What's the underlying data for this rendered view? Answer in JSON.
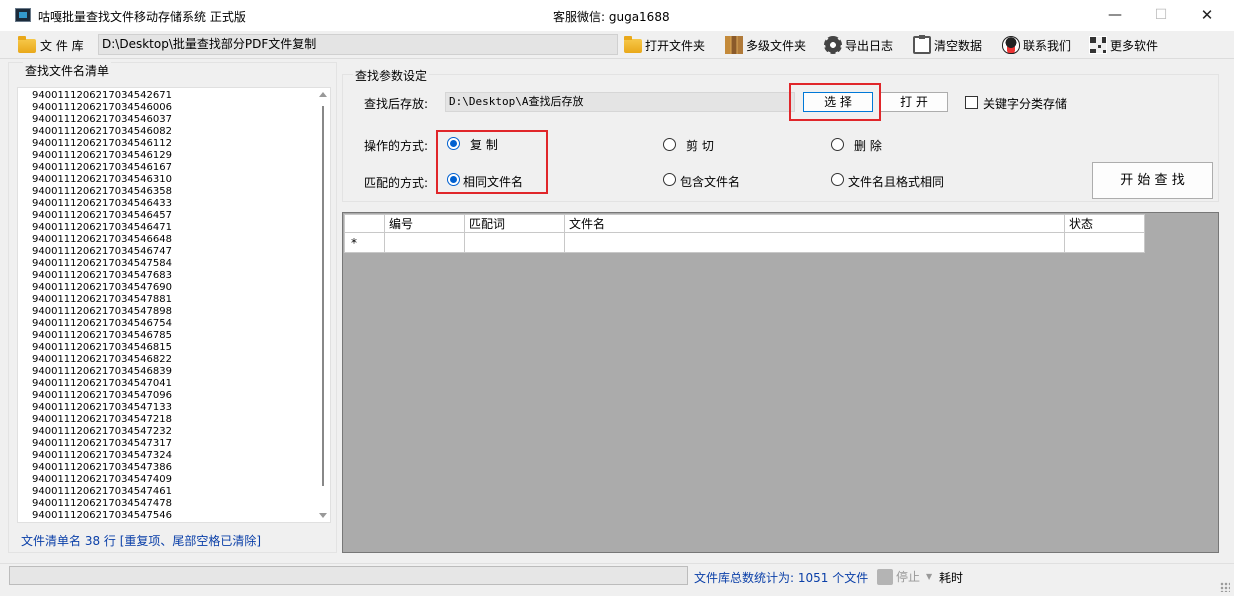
{
  "window": {
    "title": "咕嘎批量查找文件移动存储系统  正式版",
    "center_text": "客服微信: guga1688",
    "controls": {
      "minimize": "—",
      "maximize": "☐",
      "close": "✕"
    }
  },
  "toolbar": {
    "library_label": "文 件 库",
    "library_path": "D:\\Desktop\\批量查找部分PDF文件复制",
    "buttons": {
      "open_folder": "打开文件夹",
      "multi_folder": "多级文件夹",
      "export_log": "导出日志",
      "clear_data": "清空数据",
      "contact_us": "联系我们",
      "more_software": "更多软件"
    }
  },
  "file_list": {
    "title": "查找文件名清单",
    "items": [
      "9400111206217034542671",
      "9400111206217034546006",
      "9400111206217034546037",
      "9400111206217034546082",
      "9400111206217034546112",
      "9400111206217034546129",
      "9400111206217034546167",
      "9400111206217034546310",
      "9400111206217034546358",
      "9400111206217034546433",
      "9400111206217034546457",
      "9400111206217034546471",
      "9400111206217034546648",
      "9400111206217034546747",
      "9400111206217034547584",
      "9400111206217034547683",
      "9400111206217034547690",
      "9400111206217034547881",
      "9400111206217034547898",
      "9400111206217034546754",
      "9400111206217034546785",
      "9400111206217034546815",
      "9400111206217034546822",
      "9400111206217034546839",
      "9400111206217034547041",
      "9400111206217034547096",
      "9400111206217034547133",
      "9400111206217034547218",
      "9400111206217034547232",
      "9400111206217034547317",
      "9400111206217034547324",
      "9400111206217034547386",
      "9400111206217034547409",
      "9400111206217034547461",
      "9400111206217034547478",
      "9400111206217034547546"
    ],
    "status": "文件清单名 38 行  [重复项、尾部空格已清除]"
  },
  "settings": {
    "title": "查找参数设定",
    "save_label": "查找后存放:",
    "save_path": "D:\\Desktop\\A查找后存放",
    "select_button": "选  择",
    "open_button": "打  开",
    "keyword_checkbox": "关键字分类存储",
    "operation_label": "操作的方式:",
    "operations": {
      "copy": "复  制",
      "cut": "剪  切",
      "delete": "删  除"
    },
    "match_label": "匹配的方式:",
    "matches": {
      "same_name": "相同文件名",
      "contains_name": "包含文件名",
      "same_name_format": "文件名且格式相同"
    },
    "start_button": "开 始 查 找"
  },
  "grid": {
    "columns": [
      "编号",
      "匹配词",
      "文件名",
      "状态"
    ],
    "new_row_marker": "*"
  },
  "statusbar": {
    "count": "文件库总数统计为: 1051 个文件",
    "stop": "停止",
    "caret": "▼",
    "elapsed": "耗时"
  },
  "colors": {
    "highlight": "#e0262a",
    "accent_blue": "#0a3fa8",
    "grid_bg": "#ababab"
  }
}
